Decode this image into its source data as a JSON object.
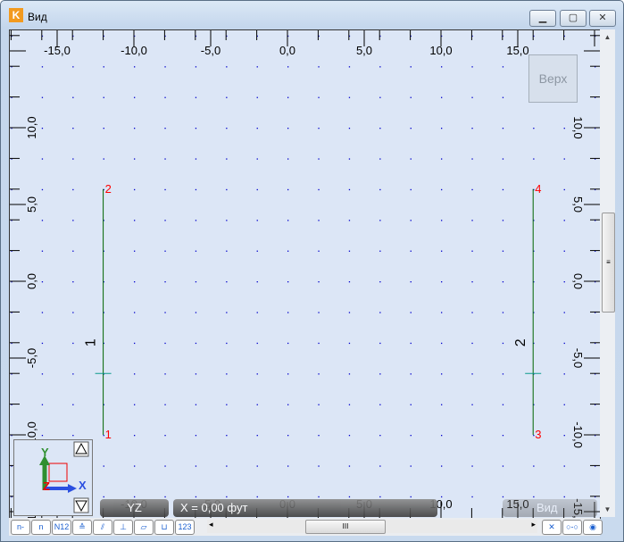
{
  "window": {
    "title": "Вид",
    "icon": "app-logo-icon",
    "buttons": [
      "minimize",
      "maximize",
      "close"
    ]
  },
  "view": {
    "cube_label": "Верх",
    "plane_label": "YZ",
    "position_readout": "X = 0,00 фут",
    "view_label": "Вид"
  },
  "axes": {
    "x_ticks": [
      "-15,0",
      "-10,0",
      "-5,0",
      "0,0",
      "5,0",
      "10,0",
      "15,0"
    ],
    "x_values": [
      -15,
      -10,
      -5,
      0,
      5,
      10,
      15
    ],
    "y_ticks": [
      "10,0",
      "5,0",
      "0,0",
      "-5,0",
      "-10,0",
      "-15,0"
    ],
    "y_values": [
      10,
      5,
      0,
      -5,
      -10,
      -15
    ]
  },
  "gizmo": {
    "x": "X",
    "y": "Y",
    "z": "Z"
  },
  "members": [
    {
      "label": "1",
      "x": -12,
      "y1": -10,
      "y2": 6,
      "node_bottom": "1",
      "node_top": "2",
      "mark_y": -6
    },
    {
      "label": "2",
      "x": 16,
      "y1": -10,
      "y2": 6,
      "node_bottom": "3",
      "node_top": "4",
      "mark_y": -6
    }
  ],
  "toolbar": {
    "left": [
      "n-",
      "n",
      "N12",
      "≙",
      "⫽",
      "⊥",
      "▱",
      "⊔",
      "123"
    ],
    "right": [
      "✕",
      "○-○",
      "◉"
    ]
  },
  "colors": {
    "member": "#006400",
    "node": "#ff0000",
    "grid_dot": "#0000cc",
    "background": "#dce6f6"
  }
}
